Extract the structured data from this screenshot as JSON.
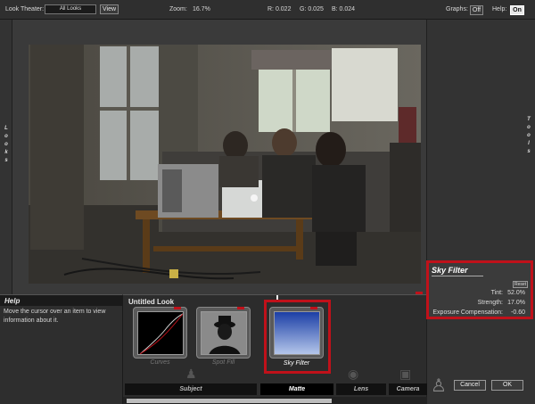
{
  "top": {
    "look_theater_label": "Look Theater:",
    "look_select": "All Looks",
    "view_button": "View",
    "zoom_label": "Zoom:",
    "zoom_value": "16.7%",
    "r": "R: 0.022",
    "g": "G: 0.025",
    "b": "B: 0.024",
    "graphs_label": "Graphs:",
    "graphs_value": "Off",
    "help_label": "Help:",
    "help_value": "On"
  },
  "side": {
    "left": "Looks",
    "right": "Tools"
  },
  "help": {
    "title": "Help",
    "text": "Move the cursor over an item to view information about it."
  },
  "look": {
    "name": "Untitled Look",
    "tools": [
      {
        "label": "Curves"
      },
      {
        "label": "Spot Fill"
      },
      {
        "label": "Sky Filter"
      }
    ],
    "tabs": [
      "Subject",
      "Matte",
      "Lens",
      "Camera"
    ],
    "active_tab": "Matte"
  },
  "sky_filter": {
    "title": "Sky Filter",
    "reset": "Reset",
    "tint_label": "Tint:",
    "tint_value": "52.0%",
    "strength_label": "Strength:",
    "strength_value": "17.0%",
    "exposure_label": "Exposure Compensation:",
    "exposure_value": "-0.60"
  },
  "buttons": {
    "cancel": "Cancel",
    "ok": "OK"
  },
  "colors": {
    "accent_red": "#c0111a",
    "sky_top": "#1c3fa6",
    "sky_bottom": "#b4c6ea"
  }
}
